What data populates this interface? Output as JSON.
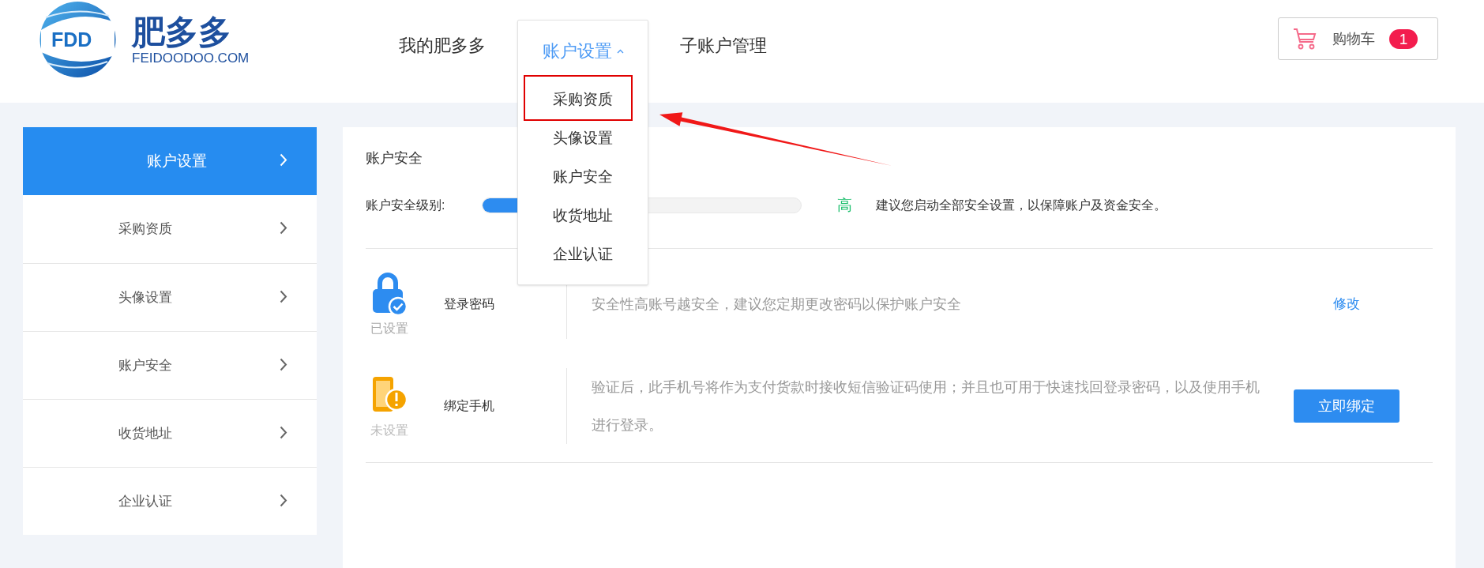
{
  "logo": {
    "mark": "FDD",
    "name": "肥多多",
    "domain": "FEIDOODOO.COM"
  },
  "nav": {
    "items": [
      {
        "label": "我的肥多多",
        "selected": false
      },
      {
        "label": "账户设置",
        "selected": true,
        "expanded": true
      },
      {
        "label": "子账户管理",
        "selected": false
      }
    ]
  },
  "dropdown": {
    "items": [
      {
        "label": "采购资质",
        "annotated": true
      },
      {
        "label": "头像设置",
        "annotated": false
      },
      {
        "label": "账户安全",
        "annotated": false
      },
      {
        "label": "收货地址",
        "annotated": false
      },
      {
        "label": "企业认证",
        "annotated": false
      }
    ]
  },
  "cart": {
    "label": "购物车",
    "count": "1"
  },
  "sidebar": {
    "items": [
      {
        "label": "账户设置",
        "selected": true
      },
      {
        "label": "采购资质",
        "selected": false
      },
      {
        "label": "头像设置",
        "selected": false
      },
      {
        "label": "账户安全",
        "selected": false
      },
      {
        "label": "收货地址",
        "selected": false
      },
      {
        "label": "企业认证",
        "selected": false
      }
    ]
  },
  "security": {
    "title": "账户安全",
    "level_label": "账户安全级别:",
    "level": 0.4,
    "level_text": "高",
    "advice": "建议您启动全部安全设置，以保障账户及资金安全。",
    "rows": [
      {
        "kind": "password",
        "set": true,
        "status": "已设置",
        "title": "登录密码",
        "description": "安全性高账号越安全，建议您定期更改密码以保护账户安全",
        "action": {
          "kind": "link",
          "label": "修改"
        }
      },
      {
        "kind": "phone",
        "set": false,
        "status": "未设置",
        "title": "绑定手机",
        "description": "验证后，此手机号将作为支付货款时接收短信验证码使用；并且也可用于快速找回登录密码，以及使用手机进行登录。",
        "action": {
          "kind": "button",
          "label": "立即绑定"
        }
      }
    ]
  }
}
